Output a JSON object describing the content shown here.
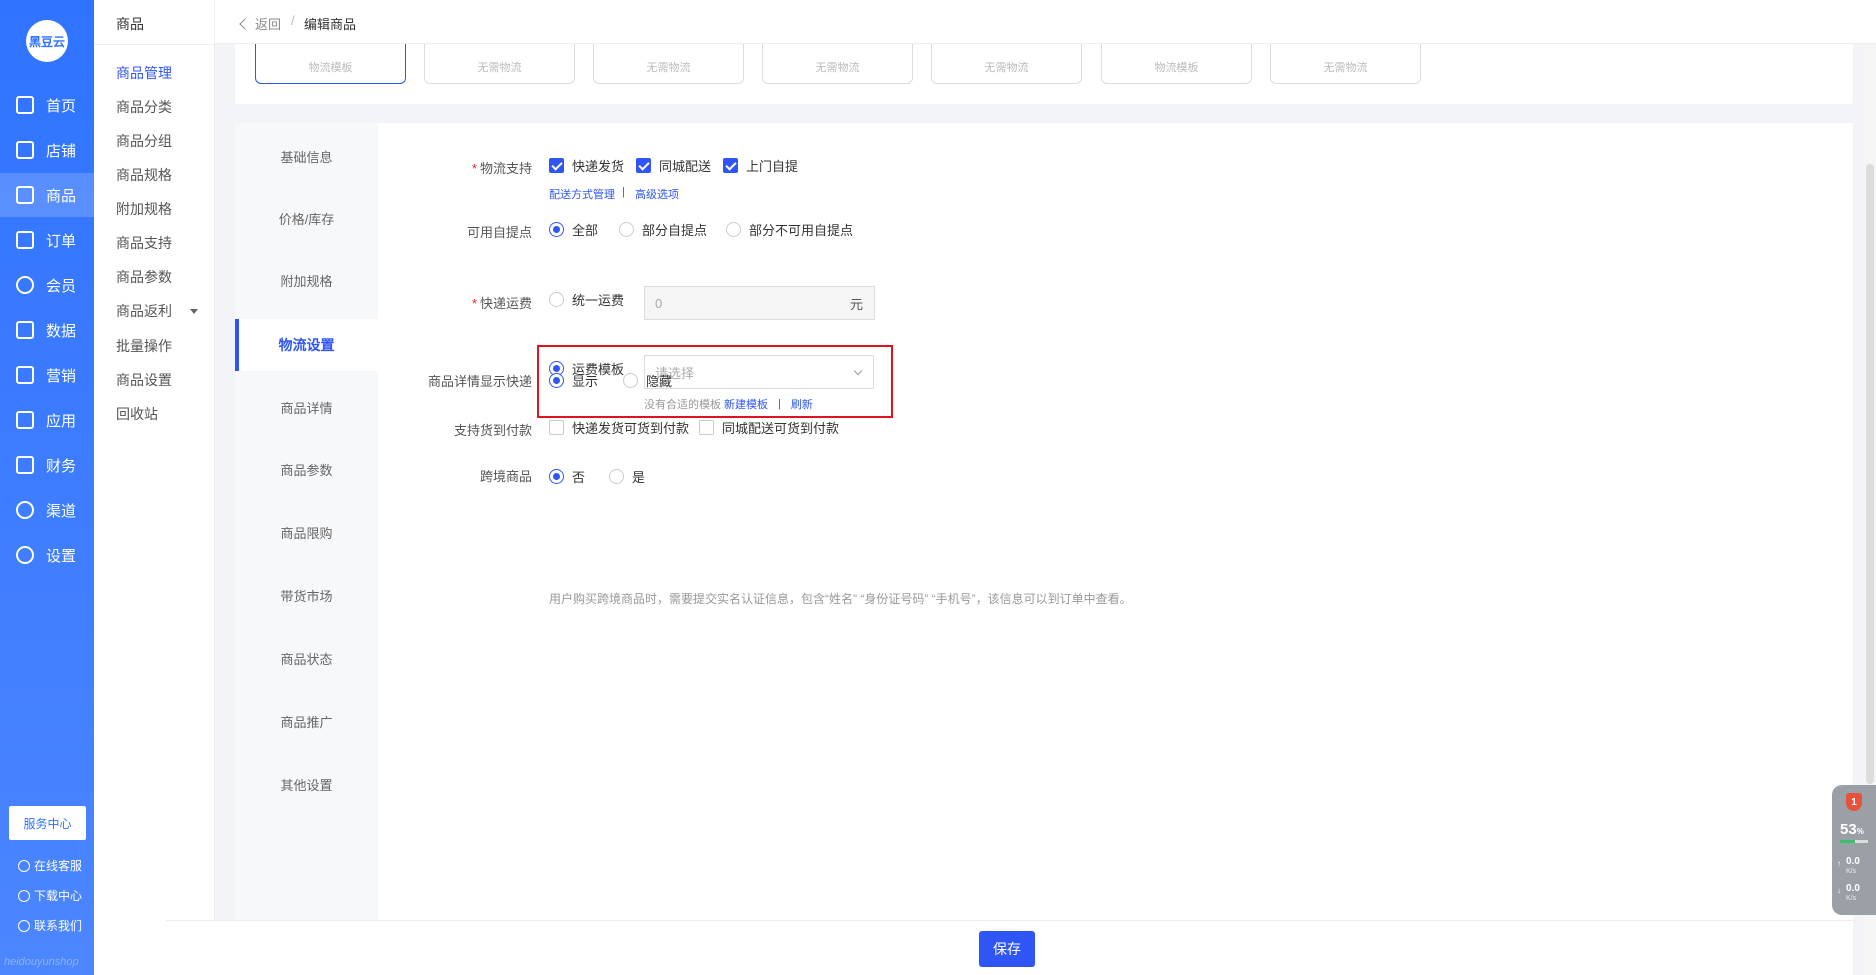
{
  "brand": {
    "logo_text": "黑豆云",
    "footer_text": "heidouyunshop"
  },
  "nav": {
    "items": [
      {
        "label": "首页",
        "icon": "home-icon"
      },
      {
        "label": "店铺",
        "icon": "store-icon"
      },
      {
        "label": "商品",
        "icon": "product-icon"
      },
      {
        "label": "订单",
        "icon": "order-icon"
      },
      {
        "label": "会员",
        "icon": "member-icon"
      },
      {
        "label": "数据",
        "icon": "data-icon"
      },
      {
        "label": "营销",
        "icon": "tag-icon"
      },
      {
        "label": "应用",
        "icon": "app-icon"
      },
      {
        "label": "财务",
        "icon": "finance-icon"
      },
      {
        "label": "渠道",
        "icon": "channel-icon"
      },
      {
        "label": "设置",
        "icon": "gear-icon"
      }
    ],
    "active_index": 2,
    "service_center": "服务中心",
    "links": [
      "在线客服",
      "下载中心",
      "联系我们"
    ]
  },
  "submenu": {
    "title": "商品",
    "items": [
      "商品管理",
      "商品分类",
      "商品分组",
      "商品规格",
      "附加规格",
      "商品支持",
      "商品参数",
      "商品返利",
      "批量操作",
      "商品设置",
      "回收站"
    ],
    "active_index": 0
  },
  "topbar": {
    "back": "返回",
    "separator": "/",
    "current": "编辑商品"
  },
  "template_tabs": [
    "物流模板",
    "无需物流",
    "无需物流",
    "无需物流",
    "无需物流",
    "物流模板",
    "无需物流"
  ],
  "section_nav": {
    "items": [
      "基础信息",
      "价格/库存",
      "附加规格",
      "物流设置",
      "商品详情",
      "商品参数",
      "商品限购",
      "带货市场",
      "商品状态",
      "商品推广",
      "其他设置"
    ],
    "active_index": 3
  },
  "form": {
    "logistics_support": {
      "label": "物流支持",
      "required": "*",
      "options": [
        "快递发货",
        "同城配送",
        "上门自提"
      ],
      "links": [
        "配送方式管理",
        "高级选项"
      ],
      "link_separator": "|"
    },
    "pickup_points": {
      "label": "可用自提点",
      "options": [
        "全部",
        "部分自提点",
        "部分不可用自提点"
      ],
      "selected": 0
    },
    "express_fee": {
      "label": "快递运费",
      "required": "*",
      "uniform_label": "统一运费",
      "uniform_value": "0",
      "unit": "元",
      "template_label": "运费模板",
      "template_placeholder": "请选择",
      "hint": "没有合适的模板",
      "new_template": "新建模板",
      "refresh": "刷新",
      "hint_separator": "|"
    },
    "detail_show_express": {
      "label": "商品详情显示快递",
      "options": [
        "显示",
        "隐藏"
      ],
      "selected": 0
    },
    "cod": {
      "label": "支持货到付款",
      "options": [
        "快递发货可货到付款",
        "同城配送可货到付款"
      ]
    },
    "cross_border": {
      "label": "跨境商品",
      "options": [
        "否",
        "是"
      ],
      "selected": 0,
      "note": "用户购买跨境商品时，需要提交实名认证信息，包含“姓名” “身份证号码” “手机号”，该信息可以到订单中查看。"
    }
  },
  "save_button": "保存",
  "widget": {
    "badge": "1",
    "percent": "53",
    "percent_unit": "%",
    "up": "0.0",
    "down": "0.0",
    "speed_unit": "K/s"
  }
}
